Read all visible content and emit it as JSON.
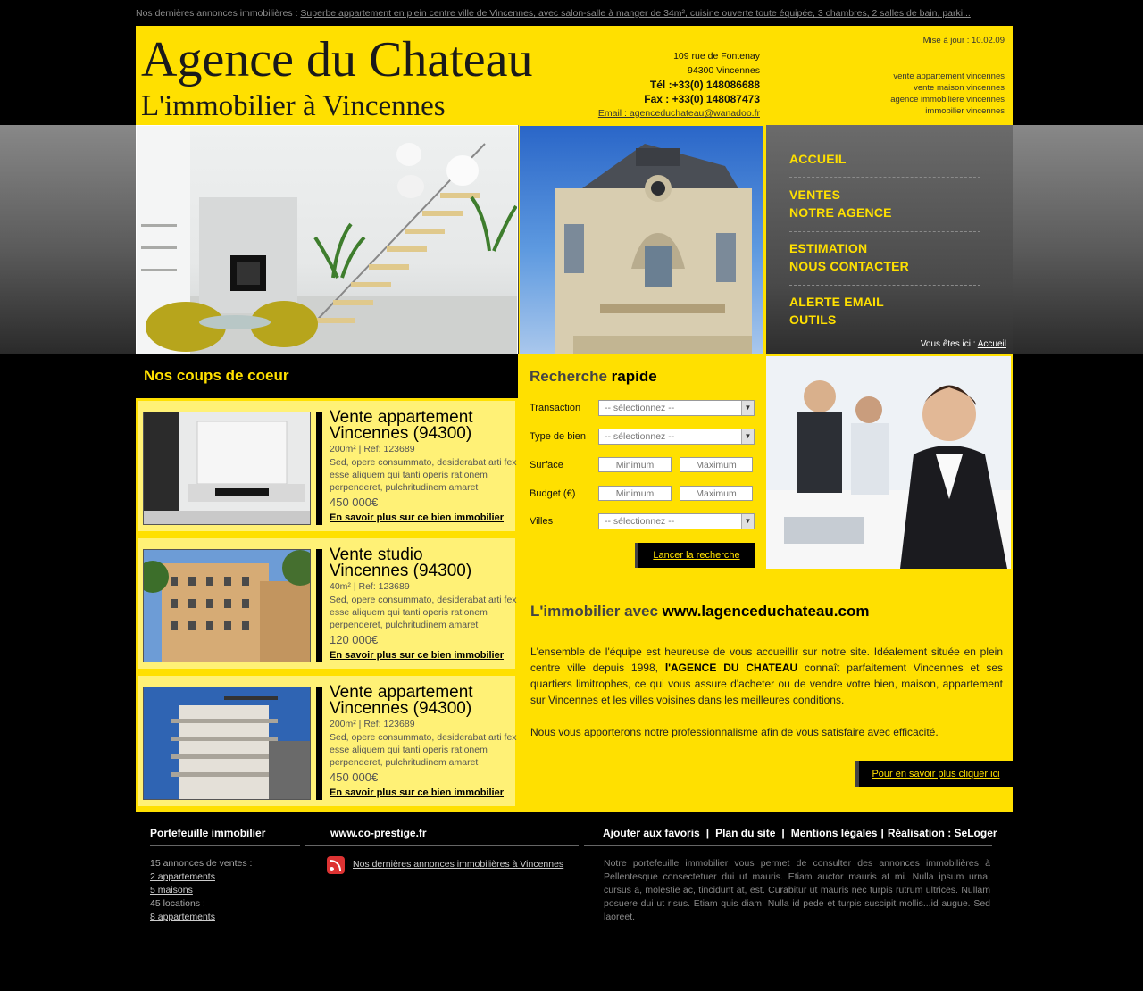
{
  "ticker": {
    "prefix": "Nos dernières annonces immobilières :",
    "link": "Superbe appartement en plein centre  ville de Vincennes, avec salon-salle à manger de 34m², cuisine ouverte toute équipée, 3 chambres, 2 salles de bain, parki..."
  },
  "header": {
    "logo_title": "Agence du Chateau",
    "logo_sub": "L'immobilier à Vincennes",
    "address1": "109 rue de Fontenay",
    "address2": "94300  Vincennes",
    "tel": "Tél :+33(0) 148086688",
    "fax": "Fax : +33(0) 148087473",
    "email": "Email : agenceduchateau@wanadoo.fr",
    "update": "Mise à jour : 10.02.09",
    "keywords": [
      "vente appartement vincennes",
      "vente maison vincennes",
      "agence immobiliere vincennes",
      "immobilier vincennes"
    ]
  },
  "nav": {
    "items": [
      [
        "ACCUEIL"
      ],
      [
        "VENTES",
        "NOTRE AGENCE"
      ],
      [
        "ESTIMATION",
        "NOUS CONTACTER"
      ],
      [
        "ALERTE EMAIL",
        "OUTILS"
      ]
    ],
    "breadcrumb_prefix": "Vous êtes ici : ",
    "breadcrumb_link": "Accueil"
  },
  "coups": {
    "title": "Nos coups de coeur",
    "cards": [
      {
        "title1": "Vente appartement",
        "title2": "Vincennes (94300)",
        "meta": "200m² | Ref: 123689",
        "desc": "Sed, opere consummato, desiderabat arti fex esse aliquem qui tanti operis rationem perpenderet, pulchritudinem amaret",
        "price": "450 000€",
        "more": "En savoir plus sur ce bien immobilier"
      },
      {
        "title1": "Vente studio",
        "title2": "Vincennes (94300)",
        "meta": "40m² | Ref: 123689",
        "desc": "Sed, opere consummato, desiderabat arti fex esse aliquem qui tanti operis rationem perpenderet, pulchritudinem amaret",
        "price": "120 000€",
        "more": "En savoir plus sur ce bien immobilier"
      },
      {
        "title1": "Vente appartement",
        "title2": "Vincennes (94300)",
        "meta": "200m² | Ref: 123689",
        "desc": "Sed, opere consummato, desiderabat arti fex esse aliquem qui tanti operis rationem perpenderet, pulchritudinem amaret",
        "price": "450 000€",
        "more": "En savoir plus sur ce bien immobilier"
      }
    ]
  },
  "search": {
    "title_a": "Recherche",
    "title_b": "rapide",
    "transaction_label": "Transaction",
    "type_label": "Type de bien",
    "surface_label": "Surface",
    "budget_label": "Budget (€)",
    "villes_label": "Villes",
    "select_placeholder": "-- sélectionnez --",
    "min_placeholder": "Minimum",
    "max_placeholder": "Maximum",
    "button": "Lancer la recherche"
  },
  "about": {
    "title_a": "L'immobilier avec",
    "title_b": "www.lagenceduchateau.com",
    "p1_a": "L'ensemble de l'équipe est heureuse de vous accueillir sur notre site. Idéalement située en plein centre ville depuis 1998,",
    "p1_b": "l'AGENCE DU CHATEAU",
    "p1_c": "connaît parfaitement Vincennes et ses quartiers limitrophes, ce qui vous assure d'acheter ou de vendre votre bien, maison, appartement sur Vincennes  et les villes voisines dans les meilleures conditions.",
    "p2": "Nous vous apporterons notre professionnalisme afin de vous satisfaire avec efficacité.",
    "button": "Pour en savoir plus cliquer ici"
  },
  "footer": {
    "col1_title": "Portefeuille immobilier",
    "col1_line1": "15 annonces de ventes :",
    "col1_link1": "2 appartements",
    "col1_link2": "5 maisons",
    "col1_line2": "45 locations :",
    "col1_link3": "8 appartements",
    "col2_title": "www.co-prestige.fr",
    "col2_link": "Nos dernières annonces immobilières à Vincennes",
    "links": [
      "Ajouter aux favoris",
      "Plan du site",
      "Mentions légales",
      "Réalisation : SeLoger"
    ],
    "col3_text": "Notre portefeuille immobilier vous permet de consulter des annonces immobilières à Pellentesque consectetuer dui ut mauris. Etiam auctor mauris at mi. Nulla ipsum urna, cursus a, molestie ac, tincidunt at, est. Curabitur ut mauris nec turpis rutrum ultrices. Nullam posuere dui ut risus. Etiam quis diam. Nulla id pede et turpis suscipit mollis...id augue. Sed laoreet."
  },
  "colors": {
    "accent": "#ffe000",
    "background": "#000000",
    "nav_bg": "#555555"
  }
}
